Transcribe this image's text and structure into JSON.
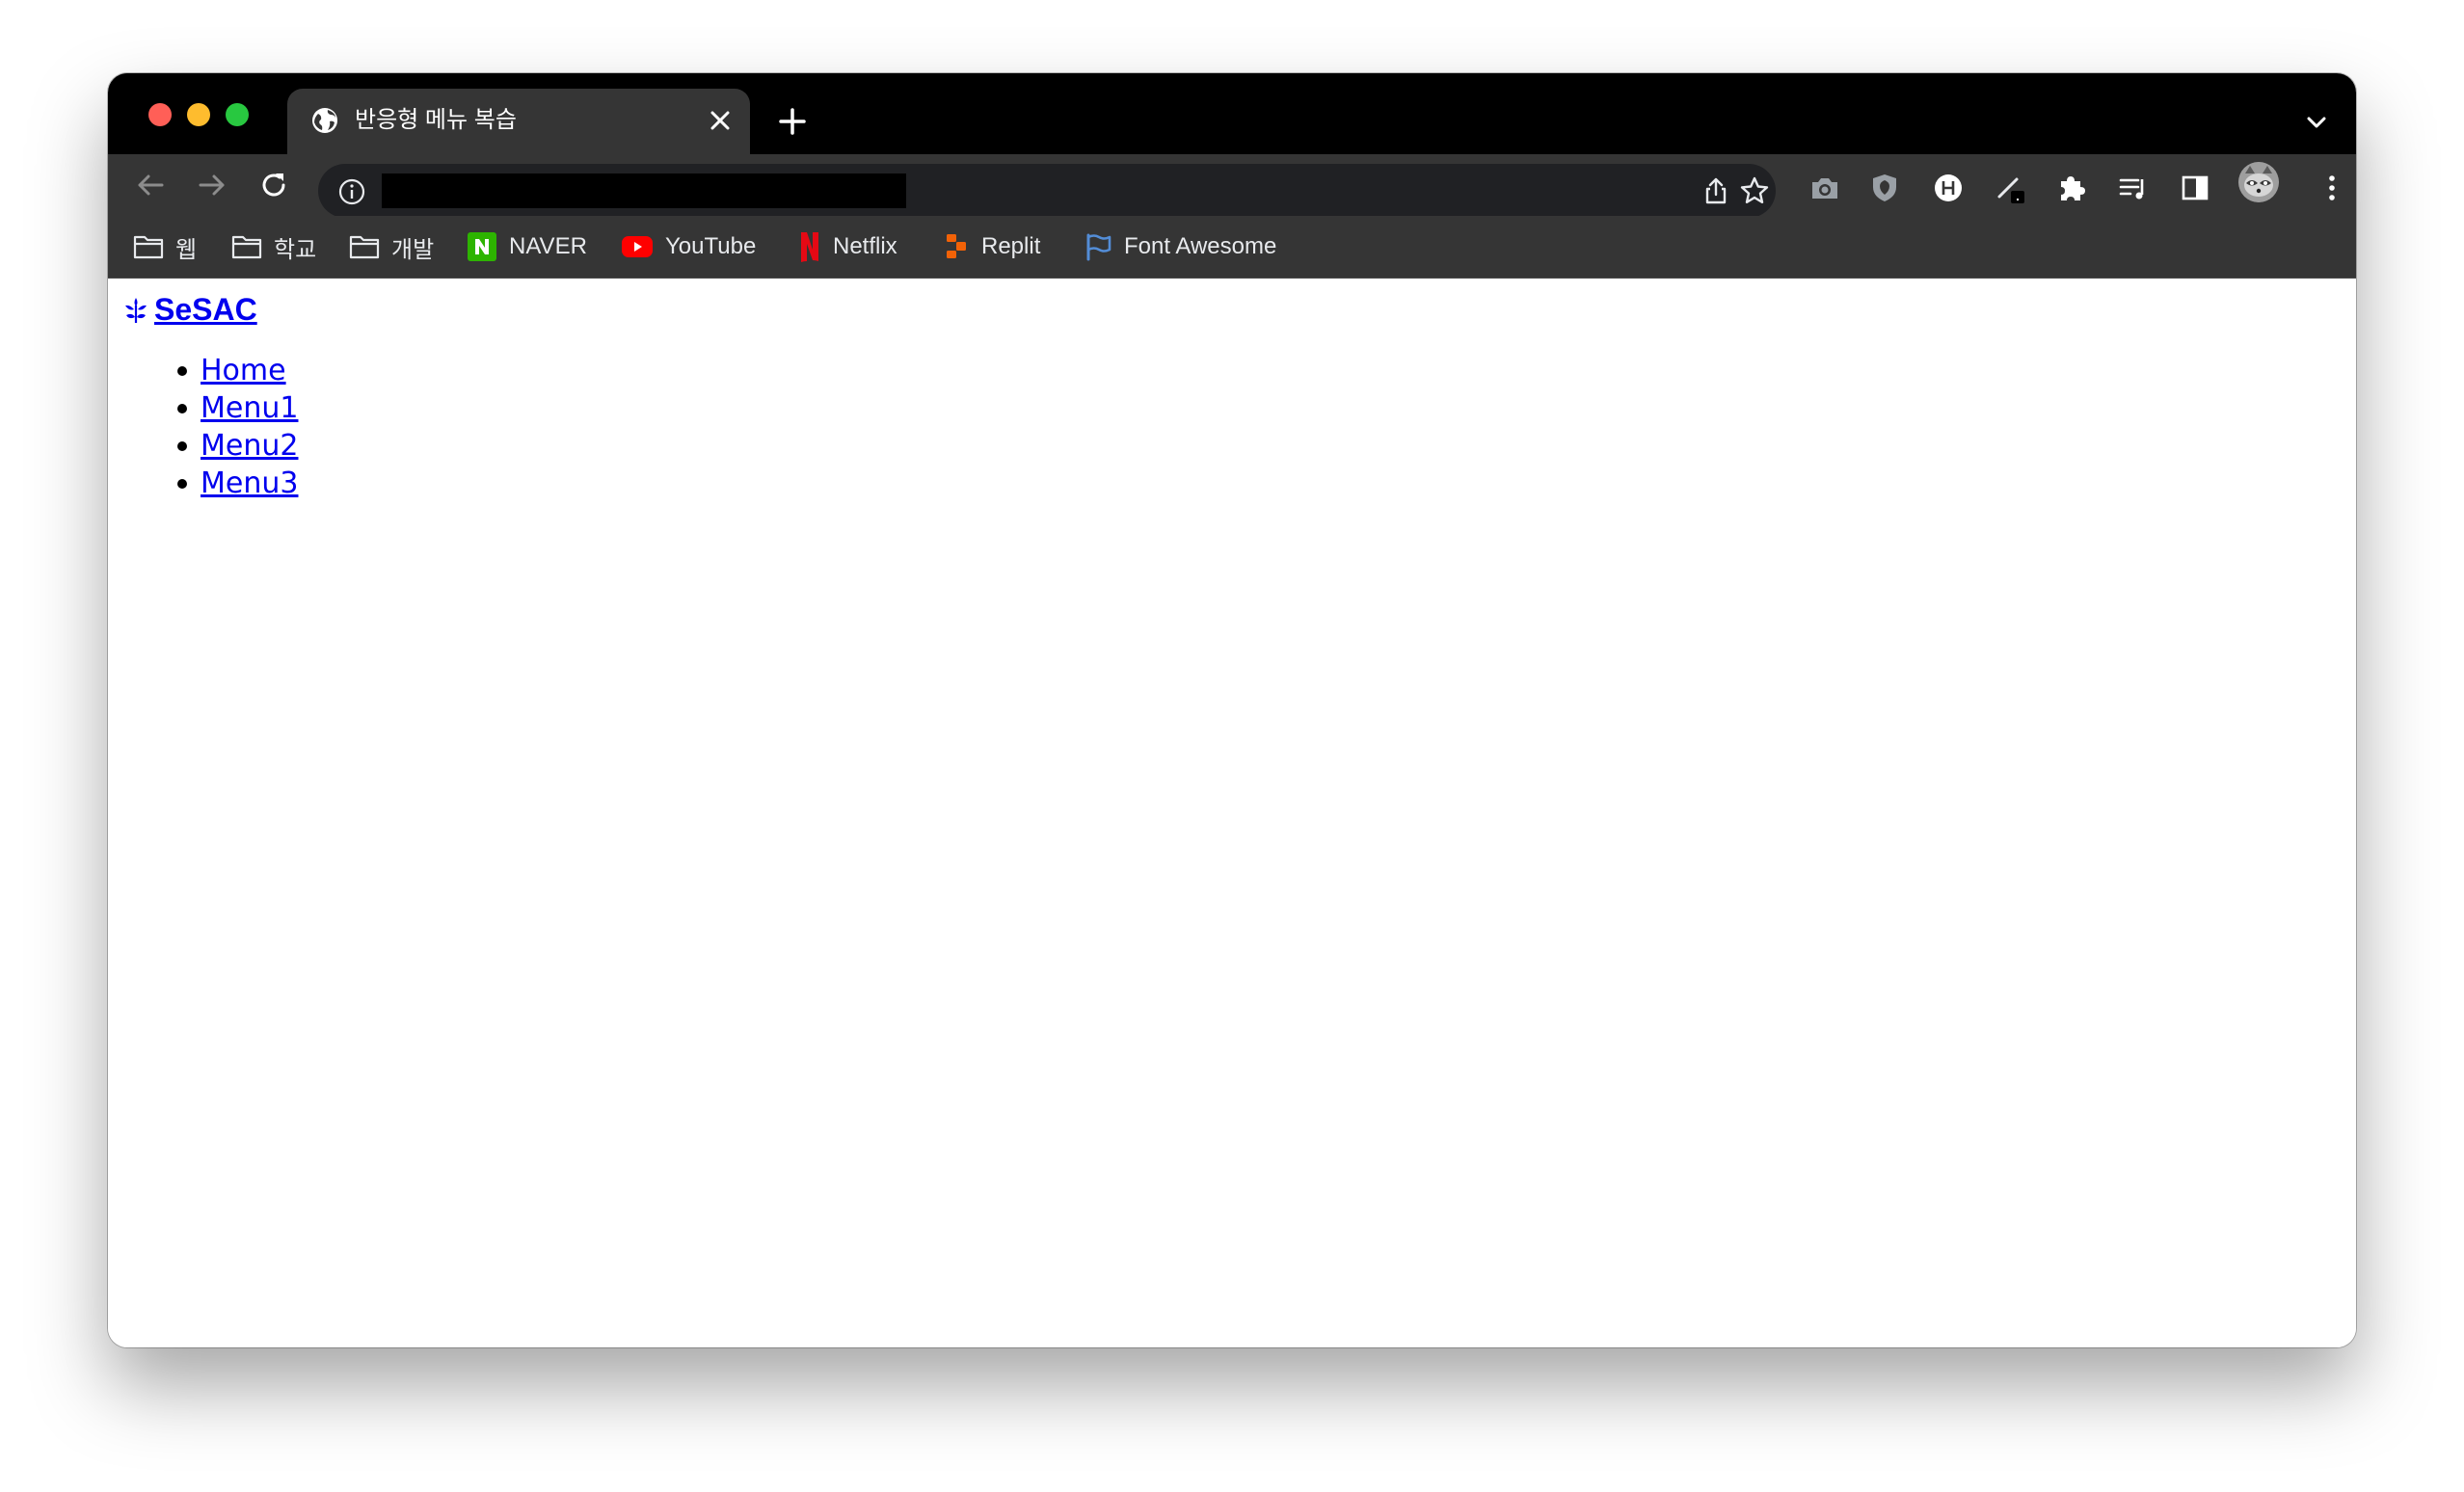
{
  "browser": {
    "tab": {
      "title": "반응형 메뉴 복습",
      "icon": "globe-icon"
    },
    "address": {
      "value": ""
    },
    "bookmarks": [
      {
        "label": "웹",
        "icon": "folder-icon"
      },
      {
        "label": "학교",
        "icon": "folder-icon"
      },
      {
        "label": "개발",
        "icon": "folder-icon"
      },
      {
        "label": "NAVER",
        "icon": "naver-icon"
      },
      {
        "label": "YouTube",
        "icon": "youtube-icon"
      },
      {
        "label": "Netflix",
        "icon": "netflix-icon"
      },
      {
        "label": "Replit",
        "icon": "replit-icon"
      },
      {
        "label": "Font Awesome",
        "icon": "font-awesome-icon"
      }
    ],
    "colors": {
      "tabbar": "#000000",
      "toolbar": "#353535",
      "link": "#0000ee"
    }
  },
  "page": {
    "logo_text": "SeSAC",
    "logo_icon": "leaf-icon",
    "menu": [
      "Home",
      "Menu1",
      "Menu2",
      "Menu3"
    ]
  }
}
